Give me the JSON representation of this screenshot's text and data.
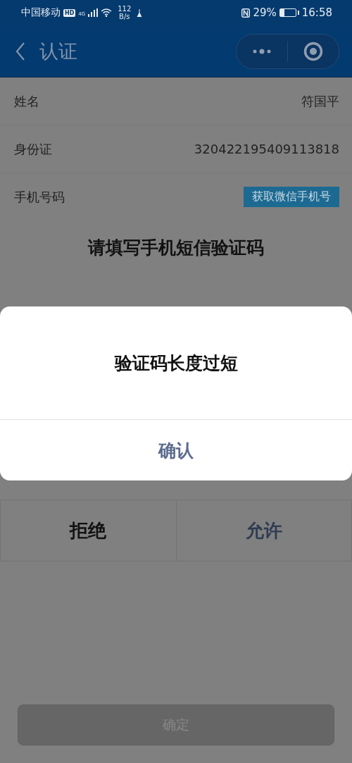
{
  "status_bar": {
    "carrier": "中国移动",
    "hd": "HD",
    "network": "4G",
    "speed_value": "112",
    "speed_unit": "B/s",
    "battery_percent": "29%",
    "time": "16:58"
  },
  "nav_bar": {
    "title": "认证"
  },
  "fields": [
    {
      "label": "姓名",
      "value": "符国平",
      "kind": "text"
    },
    {
      "label": "身份证",
      "value": "320422195409113818",
      "kind": "text"
    },
    {
      "label": "手机号码",
      "value": "获取微信手机号",
      "kind": "button"
    }
  ],
  "sms_heading": "请填写手机短信验证码",
  "permission_buttons": [
    {
      "label": "拒绝",
      "kind": "deny"
    },
    {
      "label": "允许",
      "kind": "allow"
    }
  ],
  "submit_button": {
    "label": "确定",
    "disabled": true
  },
  "dialog": {
    "message": "验证码长度过短",
    "confirm": "确认"
  }
}
